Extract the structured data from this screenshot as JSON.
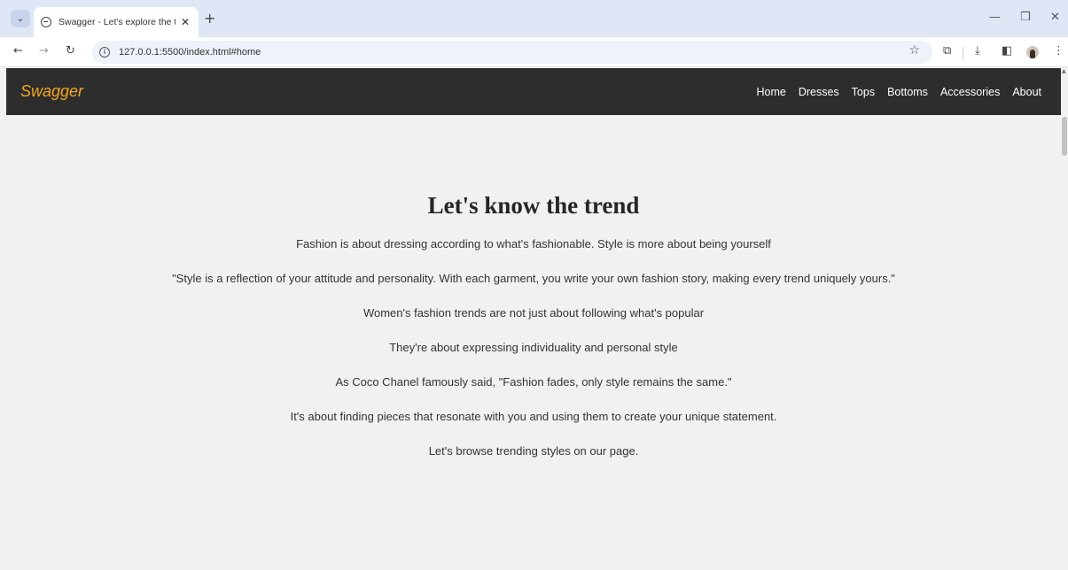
{
  "browser": {
    "tab_title": "Swagger - Let's explore the tre",
    "tab_close": "✕",
    "new_tab": "+",
    "url": "127.0.0.1:5500/index.html#home",
    "icons": [
      "tab-menu-icon",
      "globe-icon",
      "back-icon",
      "forward-icon",
      "reload-icon",
      "info-icon",
      "star-icon",
      "extensions-icon",
      "download-icon",
      "sidepanel-icon",
      "profile-icon",
      "menu-icon",
      "minimize-icon",
      "restore-icon",
      "close-icon"
    ]
  },
  "page": {
    "brand": "Swagger",
    "nav": [
      "Home",
      "Dresses",
      "Tops",
      "Bottoms",
      "Accessories",
      "About"
    ],
    "heading": "Let's know the trend",
    "paragraphs": [
      "Fashion is about dressing according to what's fashionable. Style is more about being yourself",
      "\"Style is a reflection of your attitude and personality. With each garment, you write your own fashion story, making every trend uniquely yours.\"",
      "Women's fashion trends are not just about following what's popular",
      "They're about expressing individuality and personal style",
      "As Coco Chanel famously said, \"Fashion fades, only style remains the same.\"",
      "It's about finding pieces that resonate with you and using them to create your unique statement.",
      "Let's browse trending styles on our page."
    ]
  },
  "colors": {
    "navbar": "#2d2d2d",
    "brand": "#f5a623",
    "background": "#f1f1f1",
    "text": "#333333"
  }
}
